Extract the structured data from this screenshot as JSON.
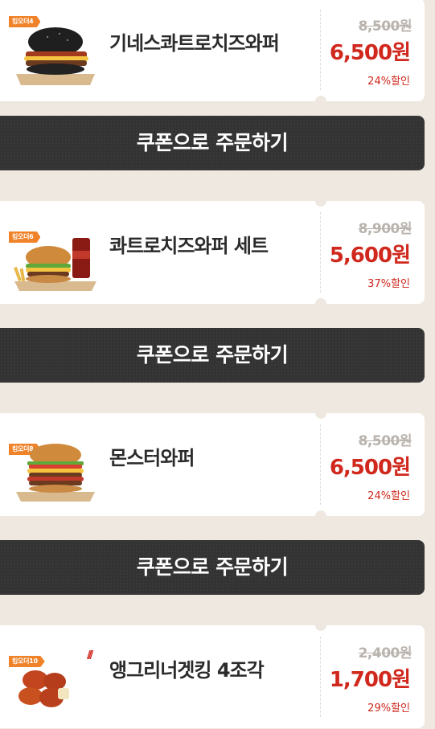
{
  "items": [
    {
      "badge": "킹오더4",
      "name": "기네스콰트로치즈와퍼",
      "original_price": "8,500원",
      "sale_price": "6,500원",
      "discount": "24%할인"
    },
    {
      "badge": "킹오더6",
      "name": "콰트로치즈와퍼 세트",
      "original_price": "8,900원",
      "sale_price": "5,600원",
      "discount": "37%할인"
    },
    {
      "badge": "킹오더8",
      "name": "몬스터와퍼",
      "original_price": "8,500원",
      "sale_price": "6,500원",
      "discount": "24%할인"
    },
    {
      "badge": "킹오더10",
      "name": "앵그리너겟킹 4조각",
      "original_price": "2,400원",
      "sale_price": "1,700원",
      "discount": "29%할인"
    }
  ],
  "order_button_label": "쿠폰으로 주문하기",
  "colors": {
    "background": "#efe8e1",
    "accent_red": "#d0281d",
    "badge_orange": "#f0832a",
    "button_dark": "#333333"
  }
}
